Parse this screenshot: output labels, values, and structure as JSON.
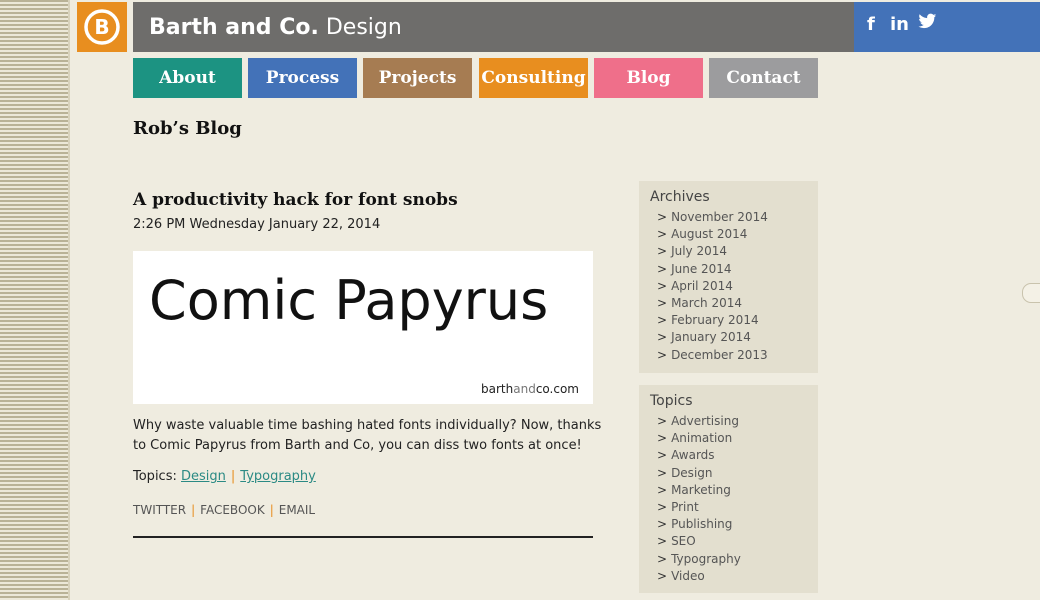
{
  "header": {
    "brand_name": "Barth and Co.",
    "brand_sub": "Design",
    "social": [
      {
        "icon": "facebook-icon",
        "glyph": "f"
      },
      {
        "icon": "linkedin-icon",
        "glyph": "in"
      },
      {
        "icon": "twitter-icon",
        "glyph": "🐦"
      }
    ]
  },
  "nav": [
    {
      "label": "About",
      "color": "#1c9382"
    },
    {
      "label": "Process",
      "color": "#4372b8"
    },
    {
      "label": "Projects",
      "color": "#a67c52"
    },
    {
      "label": "Consulting",
      "color": "#e88e1f"
    },
    {
      "label": "Blog",
      "color": "#ef6f8a"
    },
    {
      "label": "Contact",
      "color": "#9c9c9e"
    }
  ],
  "blog": {
    "title": "Rob’s Blog"
  },
  "post": {
    "title": "A productivity hack for font snobs",
    "date": "2:26 PM Wednesday January 22, 2014",
    "image_text": "Comic Papyrus",
    "image_site_a": "barth",
    "image_site_b": "and",
    "image_site_c": "co.com",
    "body": "Why waste valuable time bashing hated fonts individually? Now, thanks to Comic Papyrus from Barth and Co, you can diss two fonts at once!",
    "topics_label": "Topics:",
    "topics": [
      "Design",
      "Typography"
    ],
    "share": [
      "TWITTER",
      "FACEBOOK",
      "EMAIL"
    ]
  },
  "sidebar": {
    "archives": {
      "title": "Archives",
      "items": [
        "November 2014",
        "August 2014",
        "July 2014",
        "June 2014",
        "April 2014",
        "March 2014",
        "February 2014",
        "January 2014",
        "December 2013"
      ]
    },
    "topics": {
      "title": "Topics",
      "items": [
        "Advertising",
        "Animation",
        "Awards",
        "Design",
        "Marketing",
        "Print",
        "Publishing",
        "SEO",
        "Typography",
        "Video"
      ]
    }
  },
  "colors": {
    "logo": "#e88e1f",
    "titlebar": "#6e6d6b",
    "socialbar": "#4372b8",
    "link": "#2b8a84",
    "separator": "#e88e1f"
  }
}
